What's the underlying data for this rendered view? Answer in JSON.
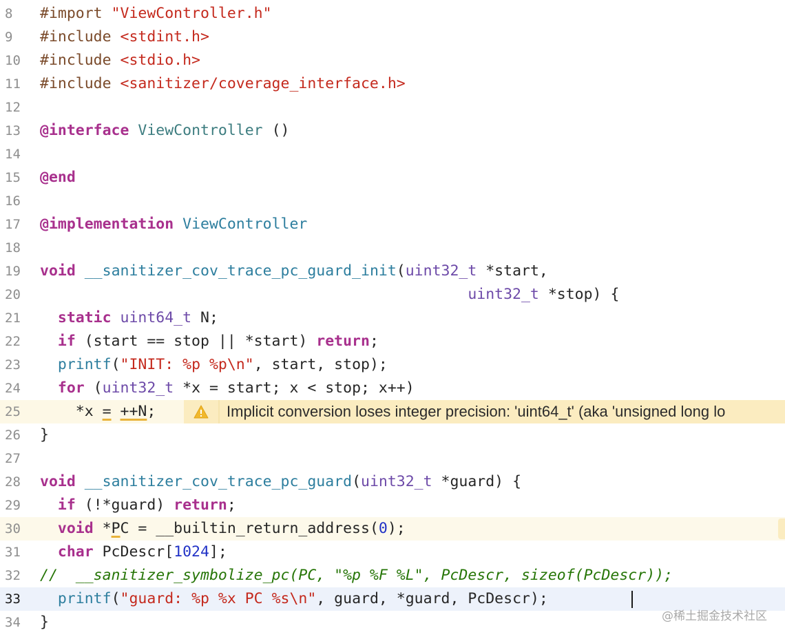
{
  "editor": {
    "lines": [
      {
        "num": "8",
        "state": "normal",
        "tokens": [
          [
            "preproc",
            "#import "
          ],
          [
            "string",
            "\"ViewController.h\""
          ]
        ]
      },
      {
        "num": "9",
        "state": "normal",
        "tokens": [
          [
            "preproc",
            "#include "
          ],
          [
            "string",
            "<stdint.h>"
          ]
        ]
      },
      {
        "num": "10",
        "state": "normal",
        "tokens": [
          [
            "preproc",
            "#include "
          ],
          [
            "string",
            "<stdio.h>"
          ]
        ]
      },
      {
        "num": "11",
        "state": "normal",
        "tokens": [
          [
            "preproc",
            "#include "
          ],
          [
            "string",
            "<sanitizer/coverage_interface.h>"
          ]
        ]
      },
      {
        "num": "12",
        "state": "normal",
        "tokens": []
      },
      {
        "num": "13",
        "state": "normal",
        "tokens": [
          [
            "keyword",
            "@interface"
          ],
          [
            "plain",
            " "
          ],
          [
            "class",
            "ViewController"
          ],
          [
            "plain",
            " ()"
          ]
        ]
      },
      {
        "num": "14",
        "state": "normal",
        "tokens": []
      },
      {
        "num": "15",
        "state": "normal",
        "tokens": [
          [
            "keyword",
            "@end"
          ]
        ]
      },
      {
        "num": "16",
        "state": "normal",
        "tokens": []
      },
      {
        "num": "17",
        "state": "normal",
        "tokens": [
          [
            "keyword",
            "@implementation"
          ],
          [
            "plain",
            " "
          ],
          [
            "func",
            "ViewController"
          ]
        ]
      },
      {
        "num": "18",
        "state": "normal",
        "tokens": []
      },
      {
        "num": "19",
        "state": "normal",
        "tokens": [
          [
            "keyword",
            "void"
          ],
          [
            "plain",
            " "
          ],
          [
            "func",
            "__sanitizer_cov_trace_pc_guard_init"
          ],
          [
            "plain",
            "("
          ],
          [
            "type",
            "uint32_t"
          ],
          [
            "plain",
            " *start,"
          ]
        ]
      },
      {
        "num": "20",
        "state": "normal",
        "tokens": [
          [
            "plain",
            "                                                "
          ],
          [
            "type",
            "uint32_t"
          ],
          [
            "plain",
            " *stop) {"
          ]
        ]
      },
      {
        "num": "21",
        "state": "normal",
        "tokens": [
          [
            "plain",
            "  "
          ],
          [
            "keyword",
            "static"
          ],
          [
            "plain",
            " "
          ],
          [
            "type",
            "uint64_t"
          ],
          [
            "plain",
            " N;"
          ]
        ]
      },
      {
        "num": "22",
        "state": "normal",
        "tokens": [
          [
            "plain",
            "  "
          ],
          [
            "keyword",
            "if"
          ],
          [
            "plain",
            " (start == stop || *start) "
          ],
          [
            "keyword",
            "return"
          ],
          [
            "plain",
            ";"
          ]
        ]
      },
      {
        "num": "23",
        "state": "normal",
        "tokens": [
          [
            "plain",
            "  "
          ],
          [
            "func",
            "printf"
          ],
          [
            "plain",
            "("
          ],
          [
            "string",
            "\"INIT: %p %p\\n\""
          ],
          [
            "plain",
            ", start, stop);"
          ]
        ]
      },
      {
        "num": "24",
        "state": "normal",
        "tokens": [
          [
            "plain",
            "  "
          ],
          [
            "keyword",
            "for"
          ],
          [
            "plain",
            " ("
          ],
          [
            "type",
            "uint32_t"
          ],
          [
            "plain",
            " *x = start; x < stop; x++)"
          ]
        ]
      },
      {
        "num": "25",
        "state": "warning",
        "tokens": [
          [
            "plain",
            "    *x "
          ],
          [
            "uline",
            "="
          ],
          [
            "plain",
            " "
          ],
          [
            "uline",
            "++N"
          ],
          [
            "plain",
            ";"
          ]
        ]
      },
      {
        "num": "26",
        "state": "normal",
        "tokens": [
          [
            "plain",
            "}"
          ]
        ]
      },
      {
        "num": "27",
        "state": "normal",
        "tokens": []
      },
      {
        "num": "28",
        "state": "normal",
        "tokens": [
          [
            "keyword",
            "void"
          ],
          [
            "plain",
            " "
          ],
          [
            "func",
            "__sanitizer_cov_trace_pc_guard"
          ],
          [
            "plain",
            "("
          ],
          [
            "type",
            "uint32_t"
          ],
          [
            "plain",
            " *guard) {"
          ]
        ]
      },
      {
        "num": "29",
        "state": "normal",
        "tokens": [
          [
            "plain",
            "  "
          ],
          [
            "keyword",
            "if"
          ],
          [
            "plain",
            " (!*guard) "
          ],
          [
            "keyword",
            "return"
          ],
          [
            "plain",
            ";"
          ]
        ]
      },
      {
        "num": "30",
        "state": "lightwarn",
        "tokens": [
          [
            "plain",
            "  "
          ],
          [
            "keyword",
            "void"
          ],
          [
            "plain",
            " *"
          ],
          [
            "uline",
            "P"
          ],
          [
            "plain",
            "C = __builtin_return_address("
          ],
          [
            "number",
            "0"
          ],
          [
            "plain",
            ");"
          ]
        ]
      },
      {
        "num": "31",
        "state": "normal",
        "tokens": [
          [
            "plain",
            "  "
          ],
          [
            "keyword",
            "char"
          ],
          [
            "plain",
            " PcDescr["
          ],
          [
            "number",
            "1024"
          ],
          [
            "plain",
            "];"
          ]
        ]
      },
      {
        "num": "32",
        "state": "normal",
        "tokens": [
          [
            "comment",
            "//  __sanitizer_symbolize_pc(PC, \"%p %F %L\", PcDescr, sizeof(PcDescr));"
          ]
        ]
      },
      {
        "num": "33",
        "state": "current",
        "tokens": [
          [
            "plain",
            "  "
          ],
          [
            "func",
            "printf"
          ],
          [
            "plain",
            "("
          ],
          [
            "string",
            "\"guard: %p %x PC %s\\n\""
          ],
          [
            "plain",
            ", guard, *guard, PcDescr); "
          ]
        ]
      },
      {
        "num": "34",
        "state": "normal",
        "tokens": [
          [
            "plain",
            "}"
          ]
        ]
      }
    ],
    "warning": {
      "icon": "warning-triangle-icon",
      "message": "Implicit conversion loses integer precision: 'uint64_t' (aka 'unsigned long lo"
    }
  },
  "watermark": "@稀土掘金技术社区",
  "colors": {
    "keyword": "#a8308d",
    "string": "#c4291d",
    "preproc": "#7a4a2a",
    "type": "#6d4aa8",
    "function": "#2d7e9e",
    "comment": "#267507",
    "number": "#2132c6",
    "warning_banner": "#fbecc0",
    "current_line": "#edf2fb"
  }
}
